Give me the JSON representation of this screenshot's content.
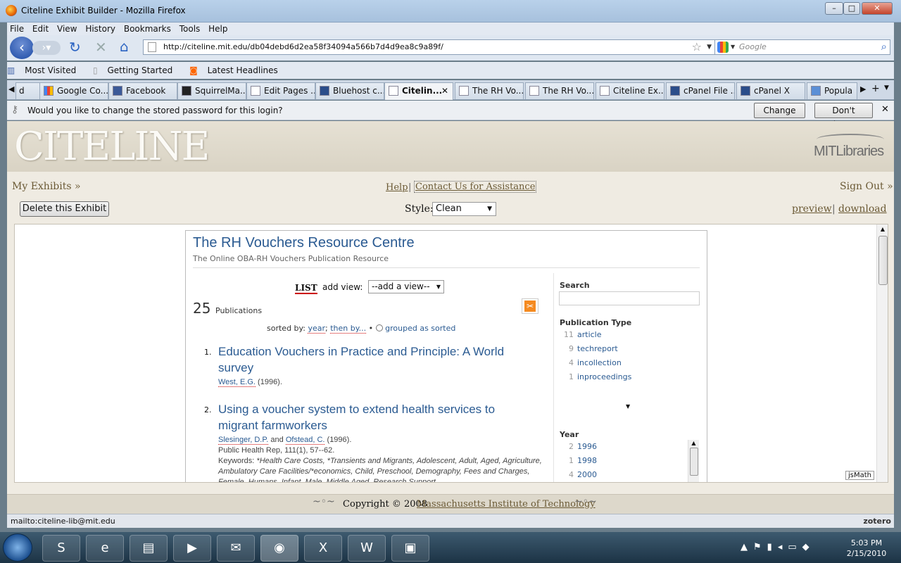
{
  "window": {
    "title": "Citeline Exhibit Builder - Mozilla Firefox",
    "min": "–",
    "max": "□",
    "close": "✕"
  },
  "menu": [
    "File",
    "Edit",
    "View",
    "History",
    "Bookmarks",
    "Tools",
    "Help"
  ],
  "nav": {
    "url": "http://citeline.mit.edu/db04debd6d2ea58f34094a566b7d4d9ea8c9a89f/",
    "search_placeholder": "Google"
  },
  "bookmarks": [
    "Most Visited",
    "Getting Started",
    "Latest Headlines"
  ],
  "tabs": [
    {
      "label": "d",
      "active": false
    },
    {
      "label": "Google Co...",
      "active": false
    },
    {
      "label": "Facebook",
      "active": false
    },
    {
      "label": "SquirrelMa...",
      "active": false
    },
    {
      "label": "Edit Pages ...",
      "active": false
    },
    {
      "label": "Bluehost c...",
      "active": false
    },
    {
      "label": "Citelin...",
      "active": true
    },
    {
      "label": "The RH Vo...",
      "active": false
    },
    {
      "label": "The RH Vo...",
      "active": false
    },
    {
      "label": "Citeline Ex...",
      "active": false
    },
    {
      "label": "cPanel File ...",
      "active": false
    },
    {
      "label": "cPanel X",
      "active": false
    },
    {
      "label": "Popula",
      "active": false
    }
  ],
  "password_bar": {
    "message": "Would you like to change the stored password for this login?",
    "change": "Change",
    "dont_change": "Don't Change"
  },
  "page": {
    "logo": "CITELINE",
    "mit": "MITLibraries",
    "my_exhibits": "My Exhibits »",
    "help": "Help",
    "sep": "|",
    "contact": "Contact Us for Assistance",
    "sign_out": "Sign Out »",
    "delete_btn": "Delete this Exhibit",
    "style_label": "Style:",
    "style_value": "Clean",
    "preview": "preview",
    "download": "download",
    "copyright_prefix": "Copyright © 2008",
    "copyright_link": "Massachusetts Institute of Technology",
    "jsmath": "jsMath"
  },
  "exhibit": {
    "title": "The RH Vouchers Resource Centre",
    "subtitle": "The Online OBA-RH Vouchers Publication Resource",
    "view_list": "LIST",
    "add_view_label": "add view:",
    "add_view_value": "--add a view--",
    "count": "25",
    "count_label": "Publications",
    "sorted_by": "sorted by:",
    "sort_year": "year",
    "then_by": "then by...",
    "bullet": "•",
    "grouped": "grouped as sorted",
    "items": [
      {
        "num": "1.",
        "title": "Education Vouchers in Practice and Principle: A World survey",
        "authors": [
          "West, E.G."
        ],
        "year": "(1996)."
      },
      {
        "num": "2.",
        "title": "Using a voucher system to extend health services to migrant farmworkers",
        "authors": [
          "Slesinger, D.P.",
          "Ofstead, C."
        ],
        "and": "and",
        "year": "(1996).",
        "journal": "Public Health Rep, 111(1), 57--62.",
        "keywords_label": "Keywords:",
        "keywords": "*Health Care Costs, *Transients and Migrants, Adolescent, Adult, Aged, Agriculture, Ambulatory Care Facilities/*economics, Child, Preschool, Demography, Fees and Charges, Female, Humans, Infant, Male, Middle Aged, Research Support"
      }
    ],
    "search_label": "Search",
    "pubtype_label": "Publication Type",
    "pubtypes": [
      {
        "count": "11",
        "label": "article"
      },
      {
        "count": "9",
        "label": "techreport"
      },
      {
        "count": "4",
        "label": "incollection"
      },
      {
        "count": "1",
        "label": "inproceedings"
      }
    ],
    "year_label": "Year",
    "years": [
      {
        "count": "2",
        "label": "1996"
      },
      {
        "count": "1",
        "label": "1998"
      },
      {
        "count": "4",
        "label": "2000"
      }
    ]
  },
  "status": {
    "text": "mailto:citeline-lib@mit.edu",
    "zotero": "zotero"
  },
  "clock": {
    "time": "5:03 PM",
    "date": "2/15/2010"
  }
}
